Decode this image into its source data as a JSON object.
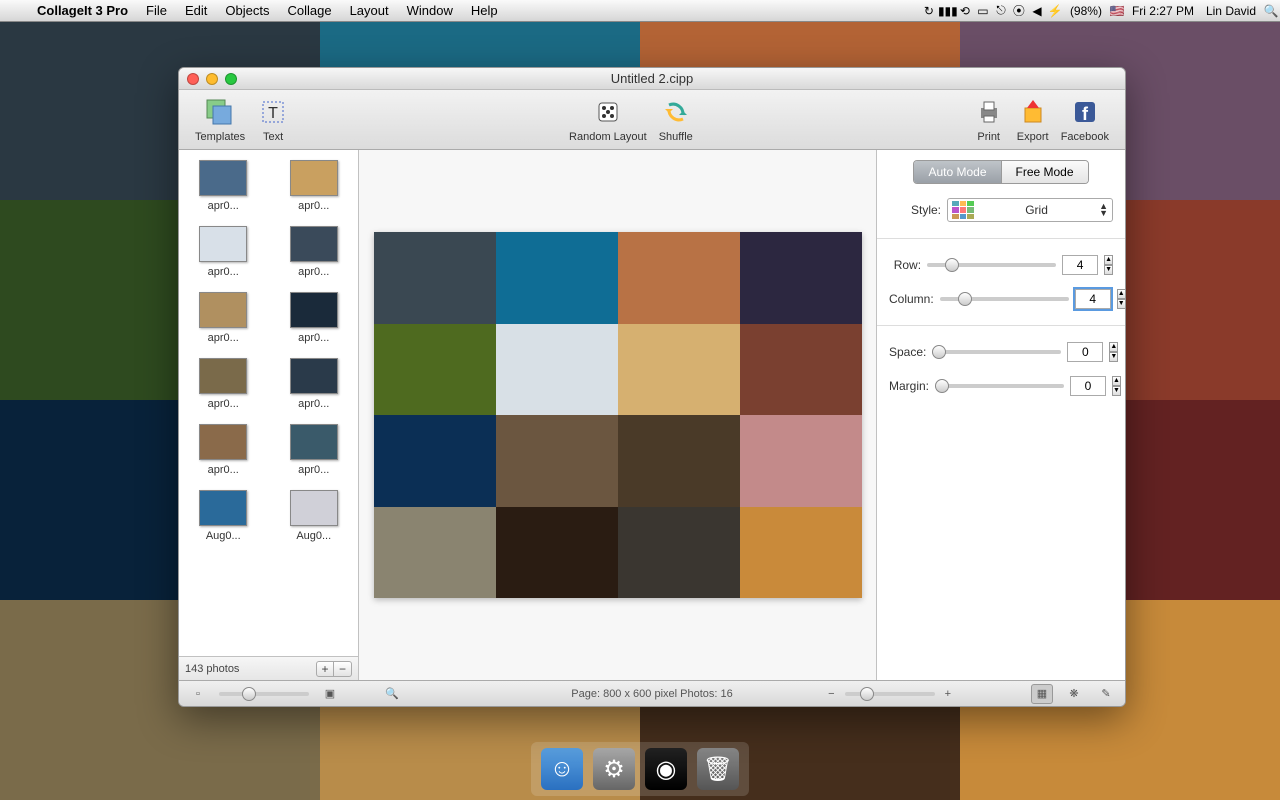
{
  "menubar": {
    "app_name": "CollageIt 3 Pro",
    "menus": [
      "File",
      "Edit",
      "Objects",
      "Collage",
      "Layout",
      "Window",
      "Help"
    ],
    "battery": "(98%)",
    "time": "Fri 2:27 PM",
    "user": "Lin David"
  },
  "window": {
    "title": "Untitled 2.cipp"
  },
  "toolbar": {
    "templates": "Templates",
    "text": "Text",
    "random_layout": "Random Layout",
    "shuffle": "Shuffle",
    "print": "Print",
    "export": "Export",
    "facebook": "Facebook"
  },
  "thumbs": [
    {
      "label": "apr0..."
    },
    {
      "label": "apr0..."
    },
    {
      "label": "apr0..."
    },
    {
      "label": "apr0..."
    },
    {
      "label": "apr0..."
    },
    {
      "label": "apr0..."
    },
    {
      "label": "apr0..."
    },
    {
      "label": "apr0..."
    },
    {
      "label": "apr0..."
    },
    {
      "label": "apr0..."
    },
    {
      "label": "Aug0..."
    },
    {
      "label": "Aug0..."
    }
  ],
  "sidebar_foot": {
    "count": "143 photos",
    "plus": "+",
    "minus": "−"
  },
  "inspector": {
    "auto_mode": "Auto Mode",
    "free_mode": "Free Mode",
    "style_label": "Style:",
    "style_value": "Grid",
    "row_label": "Row:",
    "row_value": "4",
    "column_label": "Column:",
    "column_value": "4",
    "space_label": "Space:",
    "space_value": "0",
    "margin_label": "Margin:",
    "margin_value": "0"
  },
  "footer": {
    "status": "Page: 800 x 600 pixel Photos: 16",
    "minus": "−",
    "plus": "+"
  },
  "thumb_colors": [
    "#4a6a8a",
    "#c9a060",
    "#d8e0e8",
    "#3a4a5a",
    "#b09060",
    "#1a2a3a",
    "#7a6a4a",
    "#2a3a4a",
    "#8a6a4a",
    "#3a5a6a",
    "#2a6a9a",
    "#d0d0d8"
  ]
}
